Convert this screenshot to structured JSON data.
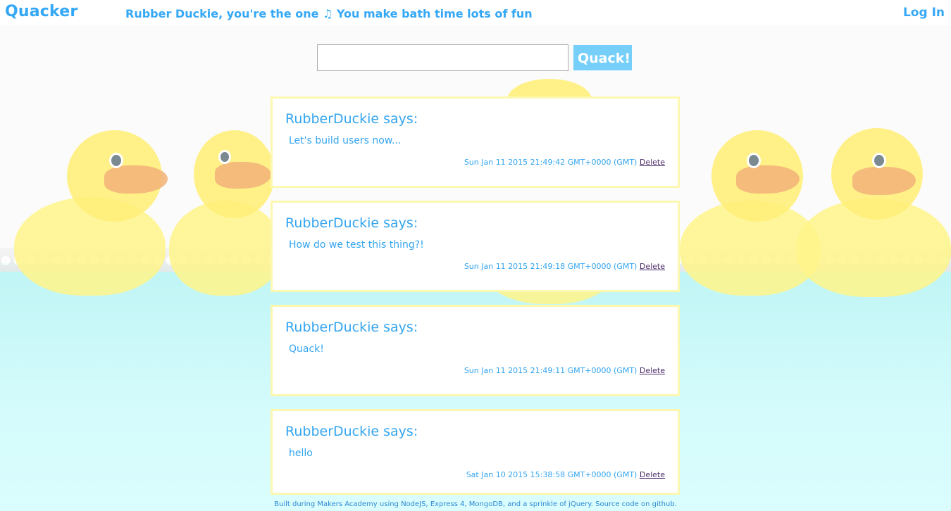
{
  "header": {
    "brand": "Quacker",
    "tagline": "Rubber Duckie, you're the one ♫ You make bath time lots of fun",
    "login_label": "Log In"
  },
  "form": {
    "input_value": "",
    "submit_label": "Quack!"
  },
  "quacks": [
    {
      "author": "RubberDuckie says:",
      "message": "Let's build users now...",
      "timestamp": "Sun Jan 11 2015 21:49:42 GMT+0000 (GMT)",
      "delete_label": "Delete"
    },
    {
      "author": "RubberDuckie says:",
      "message": "How do we test this thing?!",
      "timestamp": "Sun Jan 11 2015 21:49:18 GMT+0000 (GMT)",
      "delete_label": "Delete"
    },
    {
      "author": "RubberDuckie says:",
      "message": "Quack!",
      "timestamp": "Sun Jan 11 2015 21:49:11 GMT+0000 (GMT)",
      "delete_label": "Delete"
    },
    {
      "author": "RubberDuckie says:",
      "message": "hello",
      "timestamp": "Sat Jan 10 2015 15:38:58 GMT+0000 (GMT)",
      "delete_label": "Delete"
    }
  ],
  "footer": {
    "text": "Built during Makers Academy using NodeJS, Express 4, MongoDB, and a sprinkle of jQuery. Source code on github."
  },
  "colors": {
    "accent": "#35a8f5",
    "button": "#76cff9",
    "card_border": "#fcf8b0",
    "water": "#d5fbfc"
  },
  "background": {
    "icon": "rubber-duck-bath-icon"
  }
}
